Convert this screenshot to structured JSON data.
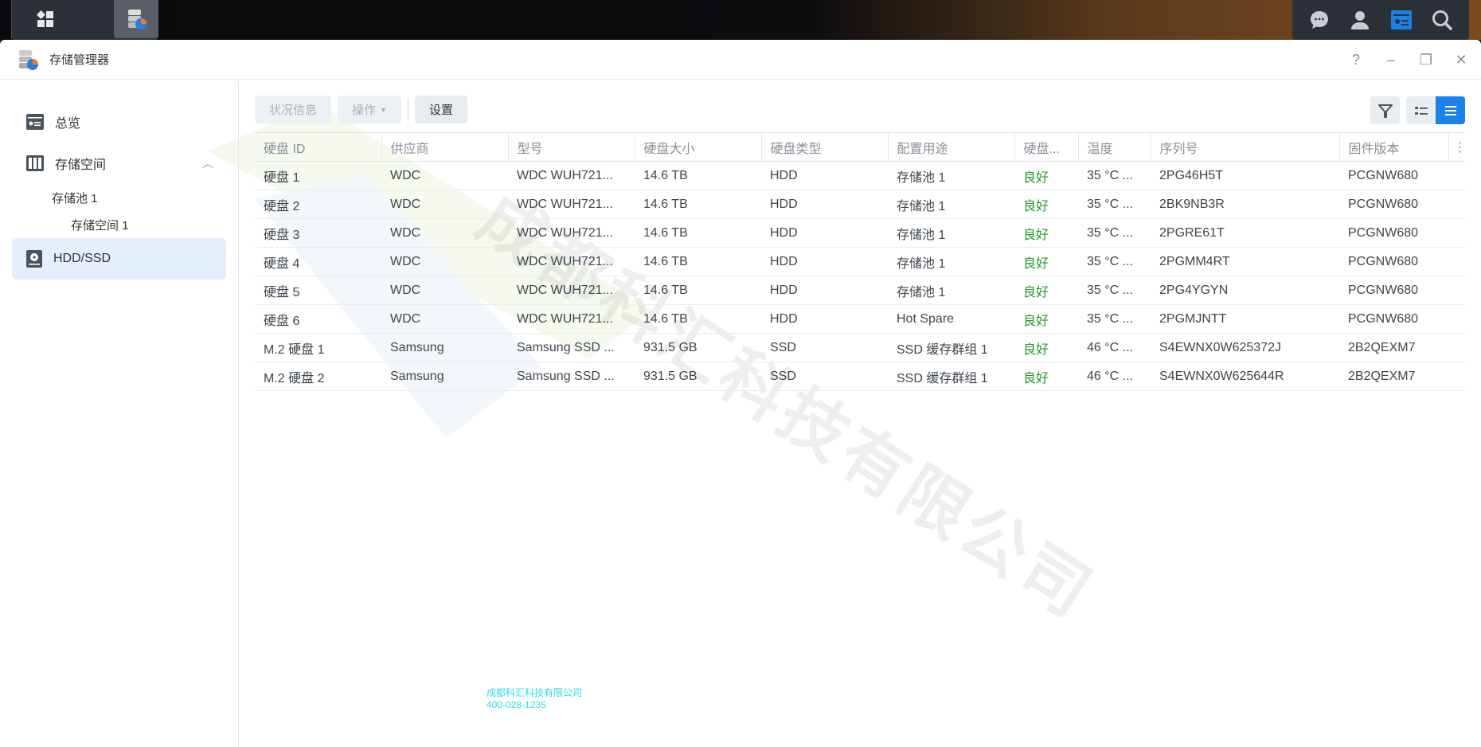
{
  "app": {
    "title": "存储管理器"
  },
  "taskbar": {
    "left_icons": [
      "main-menu-icon",
      "storage-manager-icon"
    ],
    "right_icons": [
      "chat-icon",
      "user-icon",
      "widgets-icon",
      "search-icon"
    ]
  },
  "window_controls": {
    "help": "?",
    "minimize": "–",
    "restore": "❐",
    "close": "✕"
  },
  "sidebar": {
    "items": [
      {
        "label": "总览",
        "icon": "overview-icon"
      },
      {
        "label": "存储空间",
        "icon": "storage-icon"
      },
      {
        "label": "存储池 1"
      },
      {
        "label": "存储空间 1"
      },
      {
        "label": "HDD/SSD",
        "icon": "disk-icon"
      }
    ]
  },
  "toolbar": {
    "status_info": "状况信息",
    "action": "操作",
    "settings": "设置"
  },
  "table": {
    "columns": [
      "硬盘 ID",
      "供应商",
      "型号",
      "硬盘大小",
      "硬盘类型",
      "配置用途",
      "硬盘...",
      "温度",
      "序列号",
      "固件版本"
    ],
    "rows": [
      [
        "硬盘 1",
        "WDC",
        "WDC WUH721...",
        "14.6 TB",
        "HDD",
        "存储池 1",
        "良好",
        "35 °C ...",
        "2PG46H5T",
        "PCGNW680"
      ],
      [
        "硬盘 2",
        "WDC",
        "WDC WUH721...",
        "14.6 TB",
        "HDD",
        "存储池 1",
        "良好",
        "35 °C ...",
        "2BK9NB3R",
        "PCGNW680"
      ],
      [
        "硬盘 3",
        "WDC",
        "WDC WUH721...",
        "14.6 TB",
        "HDD",
        "存储池 1",
        "良好",
        "35 °C ...",
        "2PGRE61T",
        "PCGNW680"
      ],
      [
        "硬盘 4",
        "WDC",
        "WDC WUH721...",
        "14.6 TB",
        "HDD",
        "存储池 1",
        "良好",
        "35 °C ...",
        "2PGMM4RT",
        "PCGNW680"
      ],
      [
        "硬盘 5",
        "WDC",
        "WDC WUH721...",
        "14.6 TB",
        "HDD",
        "存储池 1",
        "良好",
        "35 °C ...",
        "2PG4YGYN",
        "PCGNW680"
      ],
      [
        "硬盘 6",
        "WDC",
        "WDC WUH721...",
        "14.6 TB",
        "HDD",
        "Hot Spare",
        "良好",
        "35 °C ...",
        "2PGMJNTT",
        "PCGNW680"
      ],
      [
        "M.2 硬盘 1",
        "Samsung",
        "Samsung SSD ...",
        "931.5 GB",
        "SSD",
        "SSD 缓存群组 1",
        "良好",
        "46 °C ...",
        "S4EWNX0W625372J",
        "2B2QEXM7"
      ],
      [
        "M.2 硬盘 2",
        "Samsung",
        "Samsung SSD ...",
        "931.5 GB",
        "SSD",
        "SSD 缓存群组 1",
        "良好",
        "46 °C ...",
        "S4EWNX0W625644R",
        "2B2QEXM7"
      ]
    ]
  },
  "watermark": {
    "text": "成都科汇科技有限公司",
    "contact_name": "成都科汇科技有限公司",
    "contact_phone": "400-028-1235"
  },
  "colors": {
    "accent": "#1a82e8",
    "good": "#1f9b2a"
  }
}
